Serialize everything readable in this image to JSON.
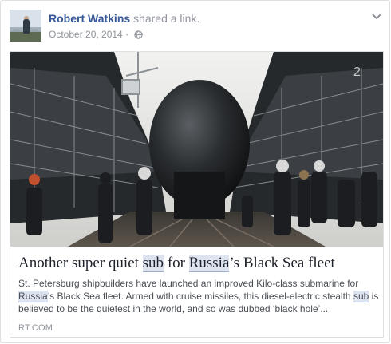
{
  "post": {
    "author": "Robert Watkins",
    "action": "shared a link.",
    "date": "October 20, 2014",
    "separator": "·",
    "privacy_icon": "globe-icon",
    "menu_icon": "chevron-down-icon"
  },
  "link": {
    "title_parts": [
      "Another super quiet ",
      "sub",
      " for ",
      "Russia",
      "’s Black Sea fleet"
    ],
    "description_parts": [
      "St. Petersburg shipbuilders have launched an improved Kilo-class submarine for ",
      "Russia",
      "’s Black Sea fleet. Armed with cruise missiles, this diesel-electric stealth ",
      "sub",
      " is believed to be the quietest in the world, and so was dubbed ‘black hole’..."
    ],
    "domain": "RT.COM",
    "image_alt": "submarine in dry dock"
  },
  "colors": {
    "link_blue": "#365899",
    "meta_gray": "#90949c",
    "highlight": "#dde4f0"
  }
}
